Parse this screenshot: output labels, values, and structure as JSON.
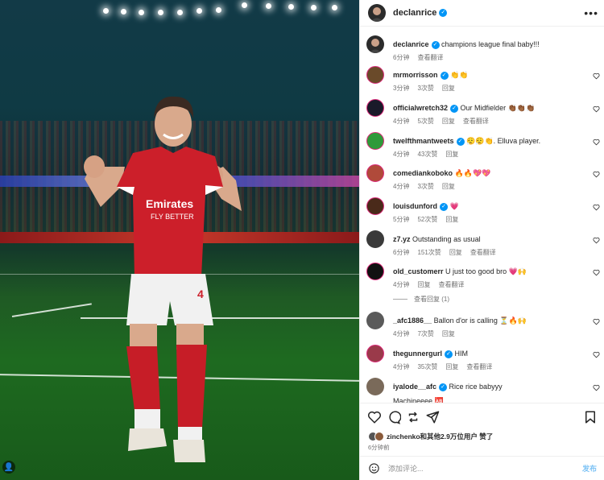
{
  "post": {
    "author": "declanrice",
    "caption": "champions league final baby!!!",
    "caption_time": "6分钟",
    "see_translation": "查看翻译",
    "more_icon": "more-horizontal-icon"
  },
  "comments": [
    {
      "user": "mrmorrisson",
      "verified": true,
      "text": "👏👏",
      "time": "3分钟",
      "likes": "3次赞",
      "reply": "回复",
      "translate": ""
    },
    {
      "user": "officialwretch32",
      "verified": true,
      "text": "Our Midfielder 👏🏾👏🏾👏🏾",
      "time": "4分钟",
      "likes": "5次赞",
      "reply": "回复",
      "translate": "查看翻译"
    },
    {
      "user": "twelfthmantweets",
      "verified": true,
      "text": "😮‍💨😮‍💨👏. Elluva player.",
      "time": "4分钟",
      "likes": "43次赞",
      "reply": "回复",
      "translate": ""
    },
    {
      "user": "comediankoboko",
      "verified": false,
      "text": "🔥🔥💖💖",
      "time": "4分钟",
      "likes": "3次赞",
      "reply": "回复",
      "translate": ""
    },
    {
      "user": "louisdunford",
      "verified": true,
      "text": "💗",
      "time": "5分钟",
      "likes": "52次赞",
      "reply": "回复",
      "translate": ""
    },
    {
      "user": "z7.yz",
      "verified": false,
      "text": "Outstanding as usual",
      "time": "6分钟",
      "likes": "151次赞",
      "reply": "回复",
      "translate": "查看翻译"
    },
    {
      "user": "old_customerr",
      "verified": false,
      "text": "U just too good bro 💗🙌",
      "time": "4分钟",
      "likes": "",
      "reply": "回复",
      "translate": "查看翻译"
    },
    {
      "user": "_afc1886__",
      "verified": false,
      "text": "Ballon d'or is calling ⏳🔥🙌",
      "time": "4分钟",
      "likes": "7次赞",
      "reply": "回复",
      "translate": ""
    },
    {
      "user": "thegunnergurl",
      "verified": true,
      "text": "HIM",
      "time": "4分钟",
      "likes": "35次赞",
      "reply": "回复",
      "translate": "查看翻译"
    },
    {
      "user": "iyalode__afc",
      "verified": true,
      "text": "Rice rice babyyy",
      "time": "",
      "likes": "",
      "reply": "",
      "translate": ""
    }
  ],
  "view_replies": "查看回复 (1)",
  "partial_comment": "Machineeee 🆎",
  "likes_summary": "zinchenko和其他2.9万位用户 赞了",
  "post_time": "6分钟前",
  "composer": {
    "placeholder": "添加评论...",
    "post_label": "发布"
  },
  "colors": {
    "verified": "#0095f6",
    "post_disabled": "#7ec3f5",
    "meta_text": "#737373"
  }
}
